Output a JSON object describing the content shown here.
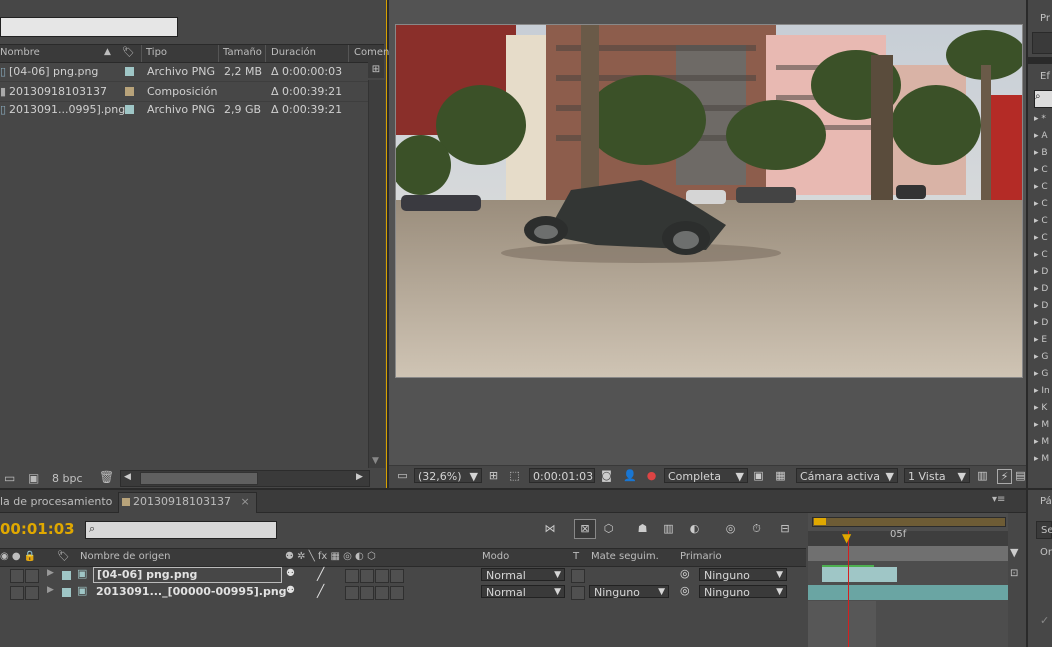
{
  "project": {
    "search_value": "",
    "columns": [
      "Nombre",
      "Tipo",
      "Tamaño",
      "Duración",
      "Coment"
    ],
    "items": [
      {
        "name": "[04-06] png.png",
        "type": "Archivo PNG",
        "size": "2,2 MB",
        "duration": "Δ 0:00:00:03",
        "tag_color": "#9fc6c6"
      },
      {
        "name": "20130918103137",
        "type": "Composición",
        "size": "",
        "duration": "Δ 0:00:39:21",
        "tag_color": "#b8a37a"
      },
      {
        "name": "2013091...0995].png",
        "type": "Archivo PNG",
        "size": "2,9 GB",
        "duration": "Δ 0:00:39:21",
        "tag_color": "#9fc6c6"
      }
    ],
    "bpc_label": "8 bpc"
  },
  "viewer": {
    "zoom": "(32,6%)",
    "timecode": "0:00:01:03",
    "resolution": "Completa",
    "camera": "Cámara activa",
    "views": "1 Vista"
  },
  "effects_panel": {
    "title_short": "Ef",
    "top_panel_short": "Pr",
    "items": [
      "*",
      "A",
      "B",
      "C",
      "C",
      "C",
      "C",
      "C",
      "C",
      "D",
      "D",
      "D",
      "D",
      "E",
      "G",
      "G",
      "In",
      "K",
      "M",
      "M",
      "M"
    ]
  },
  "timeline": {
    "tab_render": "la de procesamiento",
    "tab_comp": "20130918103137",
    "current_time": "00:01:03",
    "search_value": "",
    "columns": {
      "source_name": "Nombre de origen",
      "mode": "Modo",
      "t": "T",
      "track_matte": "Mate seguim.",
      "parent": "Primario"
    },
    "ruler_label": "05f",
    "layers": [
      {
        "name": "[04-06] png.png",
        "mode": "Normal",
        "matte": "",
        "parent": "Ninguno",
        "label_color": "#9fc6c6"
      },
      {
        "name": "2013091..._[00000-00995].png",
        "mode": "Normal",
        "matte": "Ninguno",
        "parent": "Ninguno",
        "label_color": "#9fc6c6"
      }
    ]
  },
  "right_bottom": {
    "title_short": "Pá",
    "item1": "Se",
    "item2": "Or"
  },
  "colors": {
    "accent": "#e0a800",
    "panel": "#474747",
    "cti": "#d32020",
    "layer_bar": "#6aa5a3"
  }
}
